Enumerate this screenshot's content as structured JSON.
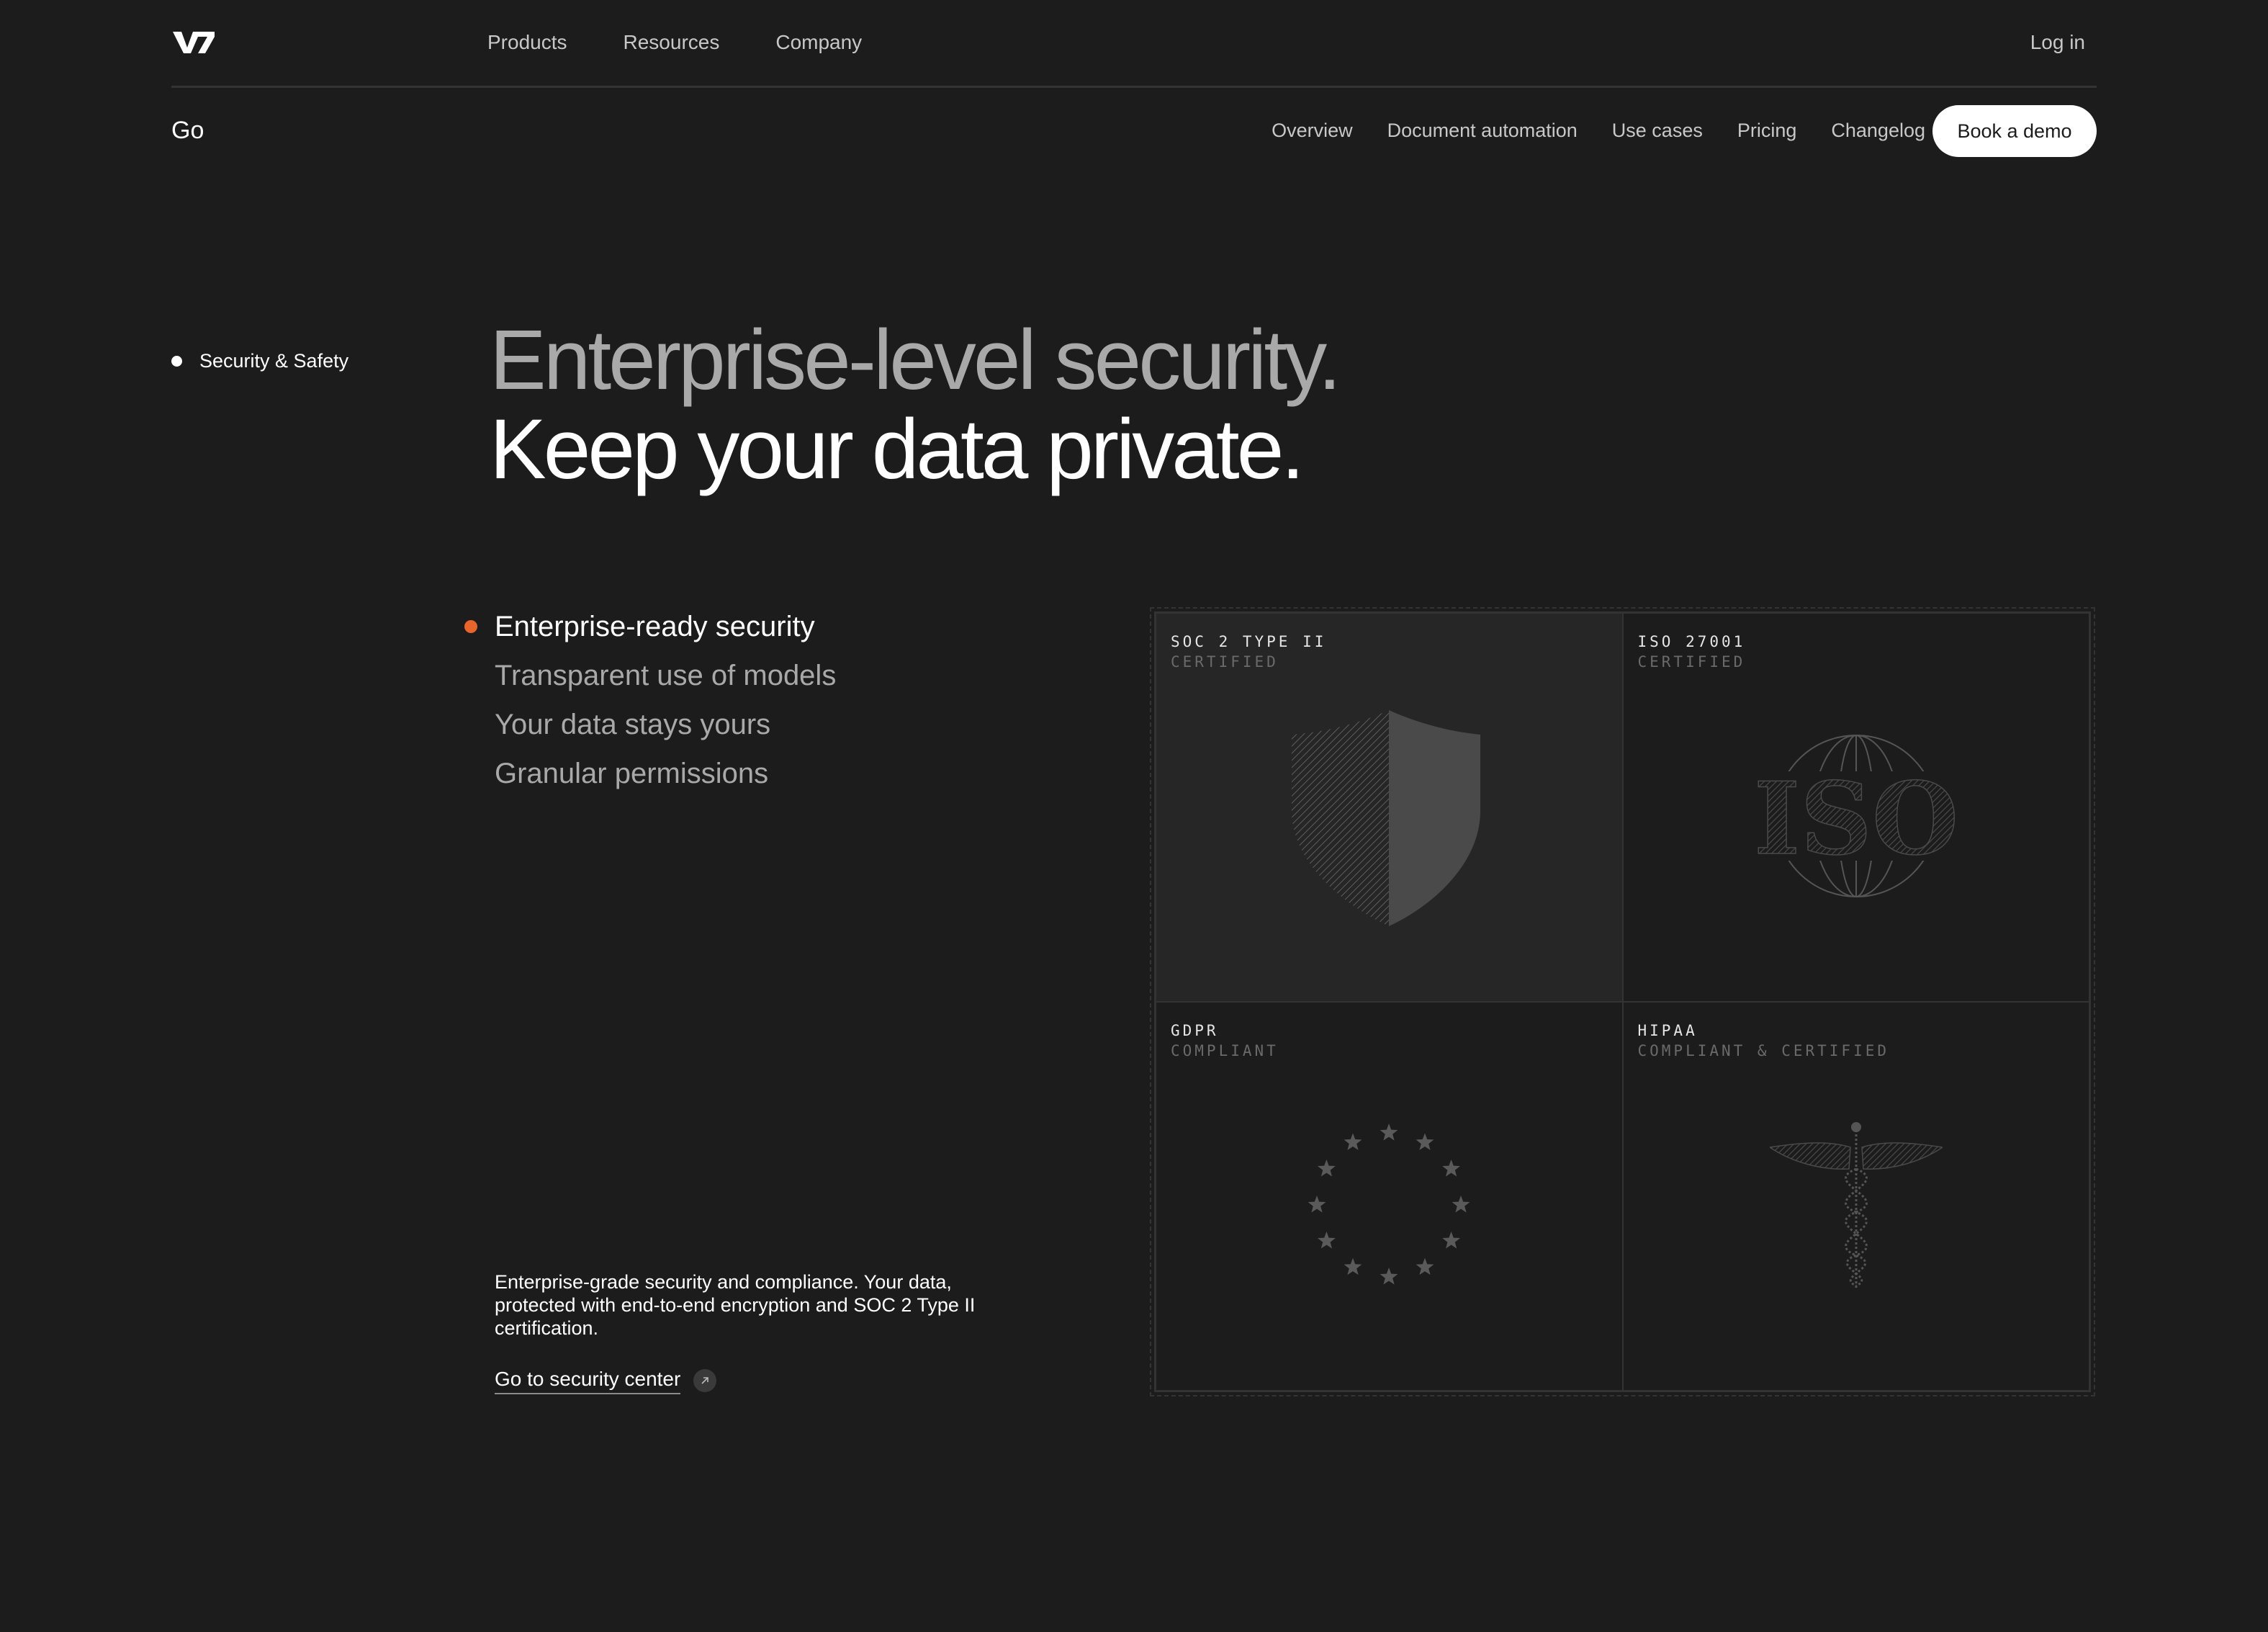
{
  "brand": {
    "logo_text": "V7"
  },
  "top_nav": {
    "items": [
      "Products",
      "Resources",
      "Company"
    ],
    "login": "Log in"
  },
  "sub_nav": {
    "product": "Go",
    "items": [
      "Overview",
      "Document automation",
      "Use cases",
      "Pricing",
      "Changelog"
    ],
    "cta": "Book a demo"
  },
  "section": {
    "label": "Security & Safety"
  },
  "headline": {
    "line1": "Enterprise-level security.",
    "line2": "Keep your data private."
  },
  "features": [
    {
      "label": "Enterprise-ready security",
      "active": true
    },
    {
      "label": "Transparent use of models",
      "active": false
    },
    {
      "label": "Your data stays yours",
      "active": false
    },
    {
      "label": "Granular permissions",
      "active": false
    }
  ],
  "description": "Enterprise-grade security and compliance. Your data, protected with end-to-end encryption and SOC 2 Type II certification.",
  "security_link": {
    "label": "Go to security center",
    "icon": "arrow-up-right-icon"
  },
  "certifications": [
    {
      "name": "SOC 2 TYPE II",
      "status": "CERTIFIED",
      "icon": "shield-icon",
      "active": true
    },
    {
      "name": "ISO 27001",
      "status": "CERTIFIED",
      "icon": "iso-globe-icon",
      "active": false,
      "art_text": "ISO"
    },
    {
      "name": "GDPR",
      "status": "COMPLIANT",
      "icon": "eu-stars-icon",
      "active": false
    },
    {
      "name": "HIPAA",
      "status": "COMPLIANT & CERTIFIED",
      "icon": "caduceus-icon",
      "active": false
    }
  ],
  "colors": {
    "background": "#1c1c1c",
    "accent": "#e8652c",
    "muted_text": "#a9a9a9",
    "button_bg": "#ffffff"
  }
}
